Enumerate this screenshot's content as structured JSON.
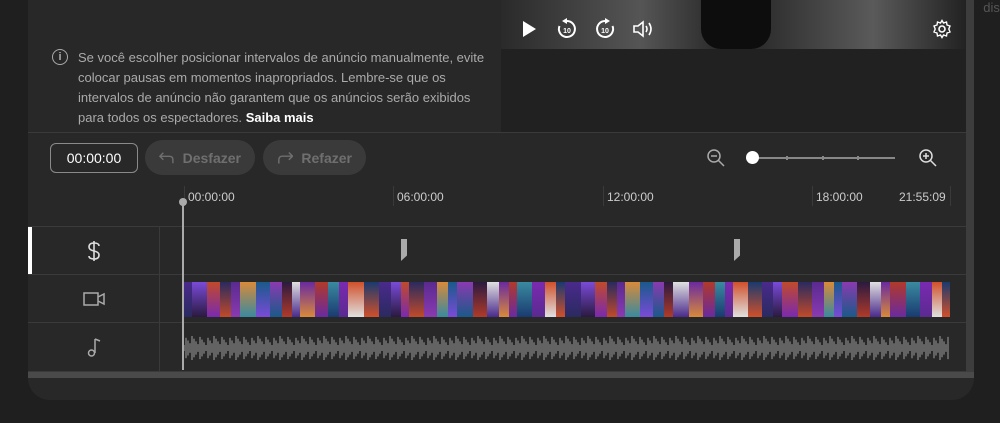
{
  "background": {
    "cut_text": "displ"
  },
  "info": {
    "text": "Se você escolher posicionar intervalos de anúncio manualmente, evite colocar pausas em momentos inapropriados. Lembre-se que os intervalos de anúncio não garantem que os anúncios serão exibidos para todos os espectadores.",
    "link": "Saiba mais"
  },
  "player": {
    "play_icon": "play-icon",
    "rewind_icon": "rewind-10-icon",
    "forward_icon": "forward-10-icon",
    "volume_icon": "volume-icon",
    "settings_icon": "settings-gear-icon"
  },
  "toolbar": {
    "time": "00:00:00",
    "undo_label": "Desfazer",
    "redo_label": "Refazer"
  },
  "ruler": {
    "labels": [
      "00:00:00",
      "06:00:00",
      "12:00:00",
      "18:00:00",
      "21:55:09"
    ]
  },
  "tracks": {
    "ad_breaks_icon": "dollar-icon",
    "video_icon": "video-camera-icon",
    "audio_icon": "music-note-icon"
  },
  "colors": {
    "frames": [
      "#4a2a8c",
      "#7a4bd8",
      "#c04a2a",
      "#2a2a60",
      "#5a2a90",
      "#d88a3a",
      "#1a5a8a",
      "#8a3ab0",
      "#2a1a40",
      "#e0e0e0",
      "#6a2aa0",
      "#b03a2a",
      "#3a8aa0",
      "#7a2ab0",
      "#d0502a",
      "#1a3a70"
    ]
  }
}
